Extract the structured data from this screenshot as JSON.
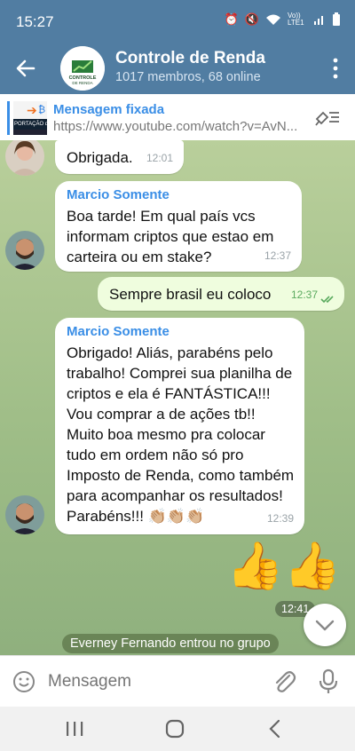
{
  "status": {
    "time": "15:27",
    "network_label": "Vo)) LTE1"
  },
  "header": {
    "title": "Controle de Renda",
    "subtitle": "1017 membros, 68 online",
    "logo_line1": "CONTROLE",
    "logo_line2": "DE RENDA"
  },
  "pinned": {
    "title": "Mensagem fixada",
    "url": "https://www.youtube.com/watch?v=AvN...",
    "thumb_text": "PORTAÇÃO de C"
  },
  "messages": {
    "m1": {
      "text": "Obrigada.",
      "time": "12:01"
    },
    "m2": {
      "sender": "Marcio Somente",
      "text": "Boa tarde! Em qual país vcs informam criptos que estao em carteira ou em stake?",
      "time": "12:37"
    },
    "m3": {
      "text": "Sempre brasil eu coloco",
      "time": "12:37"
    },
    "m4": {
      "sender": "Marcio Somente",
      "text": "Obrigado! Aliás, parabéns pelo trabalho! Comprei sua planilha de criptos e ela é FANTÁSTICA!!! Vou comprar a de ações tb!! Muito boa mesmo pra colocar tudo em ordem não só pro Imposto de Renda, como também para acompanhar os resultados! Parabéns!!!",
      "time": "12:39",
      "emoji": "👏🏼👏🏼👏🏼"
    },
    "m5": {
      "emoji": "👍👍",
      "time": "12:41"
    }
  },
  "system": {
    "join": "Everney Fernando entrou no grupo"
  },
  "composer": {
    "placeholder": "Mensagem"
  },
  "colors": {
    "header": "#517da2",
    "accent": "#3a8ee6",
    "outgoing": "#effdde"
  }
}
